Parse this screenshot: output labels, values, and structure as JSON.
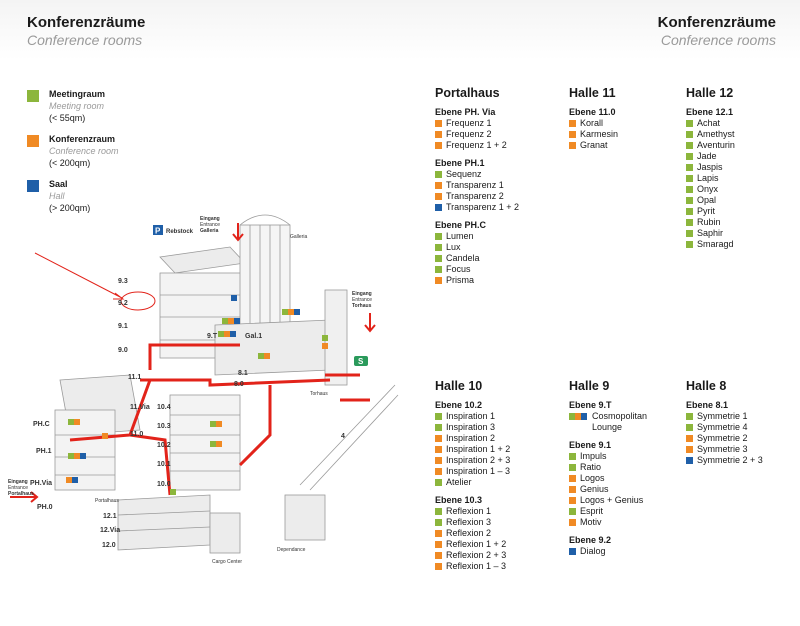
{
  "header": {
    "left_title_de": "Konferenzräume",
    "left_title_en": "Conference rooms",
    "right_title_de": "Konferenzräume",
    "right_title_en": "Conference rooms"
  },
  "colors": {
    "meeting": "#8cb63c",
    "konferenz": "#f08a24",
    "saal": "#1f5fa8",
    "route": "#e2231a"
  },
  "legend": [
    {
      "type": "meeting",
      "title": "Meetingraum",
      "subtitle": "Meeting room",
      "size": "(< 55qm)"
    },
    {
      "type": "konferenz",
      "title": "Konferenzraum",
      "subtitle": "Conference room",
      "size": "(< 200qm)"
    },
    {
      "type": "saal",
      "title": "Saal",
      "subtitle": "Hall",
      "size": "(> 200qm)"
    }
  ],
  "map": {
    "levels_left": [
      "9.3",
      "9.2",
      "9.1",
      "9.0",
      "11.1",
      "11.Via",
      "11.0",
      "PH.C",
      "PH.1",
      "PH.Via",
      "PH.0",
      "12.1",
      "12.Via",
      "12.0"
    ],
    "levels_mid": [
      "10.4",
      "10.3",
      "10.2",
      "10.1",
      "10.0"
    ],
    "labels": {
      "gal": "Gal.1",
      "level_9t": "9.T",
      "level_81": "8.1",
      "level_80": "8.0",
      "parking": "Rebstock",
      "galleria": "Galleria",
      "torhaus": "Torhaus",
      "portalhaus": "Portalhaus",
      "cargo": "Cargo Center",
      "dependance": "Dependance",
      "four": "4"
    },
    "entrances": {
      "galleria": {
        "de": "Eingang",
        "en": "Entrance",
        "name": "Galleria"
      },
      "torhaus": {
        "de": "Eingang",
        "en": "Entrance",
        "name": "Torhaus"
      },
      "portalhaus": {
        "de": "Eingang",
        "en": "Entrance",
        "name": "Portalhaus"
      }
    }
  },
  "buildings": [
    {
      "name": "Portalhaus",
      "levels": [
        {
          "name": "Ebene PH. Via",
          "rooms": [
            {
              "label": "Frequenz 1",
              "type": "konferenz"
            },
            {
              "label": "Frequenz 2",
              "type": "konferenz"
            },
            {
              "label": "Frequenz 1 + 2",
              "type": "konferenz"
            }
          ]
        },
        {
          "name": "Ebene PH.1",
          "rooms": [
            {
              "label": "Sequenz",
              "type": "meeting"
            },
            {
              "label": "Transparenz 1",
              "type": "konferenz"
            },
            {
              "label": "Transparenz 2",
              "type": "konferenz"
            },
            {
              "label": "Transparenz 1 + 2",
              "type": "saal"
            }
          ]
        },
        {
          "name": "Ebene PH.C",
          "rooms": [
            {
              "label": "Lumen",
              "type": "meeting"
            },
            {
              "label": "Lux",
              "type": "meeting"
            },
            {
              "label": "Candela",
              "type": "meeting"
            },
            {
              "label": "Focus",
              "type": "meeting"
            },
            {
              "label": "Prisma",
              "type": "konferenz"
            }
          ]
        }
      ]
    },
    {
      "name": "Halle 11",
      "levels": [
        {
          "name": "Ebene 11.0",
          "rooms": [
            {
              "label": "Korall",
              "type": "konferenz"
            },
            {
              "label": "Karmesin",
              "type": "konferenz"
            },
            {
              "label": "Granat",
              "type": "konferenz"
            }
          ]
        }
      ]
    },
    {
      "name": "Halle 12",
      "levels": [
        {
          "name": "Ebene 12.1",
          "rooms": [
            {
              "label": "Achat",
              "type": "meeting"
            },
            {
              "label": "Amethyst",
              "type": "meeting"
            },
            {
              "label": "Aventurin",
              "type": "meeting"
            },
            {
              "label": "Jade",
              "type": "meeting"
            },
            {
              "label": "Jaspis",
              "type": "meeting"
            },
            {
              "label": "Lapis",
              "type": "meeting"
            },
            {
              "label": "Onyx",
              "type": "meeting"
            },
            {
              "label": "Opal",
              "type": "meeting"
            },
            {
              "label": "Pyrit",
              "type": "meeting"
            },
            {
              "label": "Rubin",
              "type": "meeting"
            },
            {
              "label": "Saphir",
              "type": "meeting"
            },
            {
              "label": "Smaragd",
              "type": "meeting"
            }
          ]
        }
      ]
    },
    {
      "name": "Halle 10",
      "levels": [
        {
          "name": "Ebene 10.2",
          "rooms": [
            {
              "label": "Inspiration 1",
              "type": "meeting"
            },
            {
              "label": "Inspiration 3",
              "type": "meeting"
            },
            {
              "label": "Inspiration 2",
              "type": "konferenz"
            },
            {
              "label": "Inspiration 1 + 2",
              "type": "konferenz"
            },
            {
              "label": "Inspiration 2 + 3",
              "type": "konferenz"
            },
            {
              "label": "Inspiration 1 – 3",
              "type": "konferenz"
            },
            {
              "label": "Atelier",
              "type": "meeting"
            }
          ]
        },
        {
          "name": "Ebene 10.3",
          "rooms": [
            {
              "label": "Reflexion 1",
              "type": "meeting"
            },
            {
              "label": "Reflexion 3",
              "type": "meeting"
            },
            {
              "label": "Reflexion 2",
              "type": "konferenz"
            },
            {
              "label": "Reflexion 1 + 2",
              "type": "konferenz"
            },
            {
              "label": "Reflexion 2 + 3",
              "type": "konferenz"
            },
            {
              "label": "Reflexion 1 – 3",
              "type": "konferenz"
            }
          ]
        }
      ]
    },
    {
      "name": "Halle 9",
      "levels": [
        {
          "name": "Ebene 9.T",
          "rooms": [
            {
              "label": "Cosmopolitan Lounge",
              "type": "multi"
            }
          ]
        },
        {
          "name": "Ebene 9.1",
          "rooms": [
            {
              "label": "Impuls",
              "type": "meeting"
            },
            {
              "label": "Ratio",
              "type": "meeting"
            },
            {
              "label": "Logos",
              "type": "konferenz"
            },
            {
              "label": "Genius",
              "type": "konferenz"
            },
            {
              "label": "Logos + Genius",
              "type": "konferenz"
            },
            {
              "label": "Esprit",
              "type": "meeting"
            },
            {
              "label": "Motiv",
              "type": "konferenz"
            }
          ]
        },
        {
          "name": "Ebene 9.2",
          "rooms": [
            {
              "label": "Dialog",
              "type": "saal"
            }
          ]
        }
      ]
    },
    {
      "name": "Halle 8",
      "levels": [
        {
          "name": "Ebene 8.1",
          "rooms": [
            {
              "label": "Symmetrie 1",
              "type": "meeting"
            },
            {
              "label": "Symmetrie 4",
              "type": "meeting"
            },
            {
              "label": "Symmetrie 2",
              "type": "konferenz"
            },
            {
              "label": "Symmetrie 3",
              "type": "konferenz"
            },
            {
              "label": "Symmetrie 2 + 3",
              "type": "saal"
            }
          ]
        }
      ]
    }
  ]
}
